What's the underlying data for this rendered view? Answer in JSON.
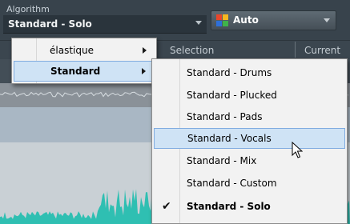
{
  "algorithm": {
    "caption": "Algorithm",
    "value": "Standard - Solo"
  },
  "preset_button": {
    "label": "Auto",
    "icon": "color-grid-icon",
    "icon_colors": [
      "#e8462b",
      "#f7b620",
      "#2e6fd8",
      "#3fb34a"
    ]
  },
  "columns": {
    "selection": "Selection",
    "current": "Current"
  },
  "algorithm_menu": {
    "items": [
      {
        "label": "élastique",
        "has_submenu": true,
        "highlighted": false
      },
      {
        "label": "Standard",
        "has_submenu": true,
        "highlighted": true
      }
    ]
  },
  "standard_submenu": {
    "items": [
      {
        "label": "Standard - Drums",
        "checked": false,
        "highlighted": false
      },
      {
        "label": "Standard - Plucked",
        "checked": false,
        "highlighted": false
      },
      {
        "label": "Standard - Pads",
        "checked": false,
        "highlighted": false
      },
      {
        "label": "Standard - Vocals",
        "checked": false,
        "highlighted": true
      },
      {
        "label": "Standard - Mix",
        "checked": false,
        "highlighted": false
      },
      {
        "label": "Standard - Custom",
        "checked": false,
        "highlighted": false
      },
      {
        "label": "Standard - Solo",
        "checked": true,
        "highlighted": false
      }
    ]
  },
  "colors": {
    "waveform": "#2fbfb2",
    "highlight_fill": "#cfe3f5",
    "highlight_border": "#80ace0"
  }
}
